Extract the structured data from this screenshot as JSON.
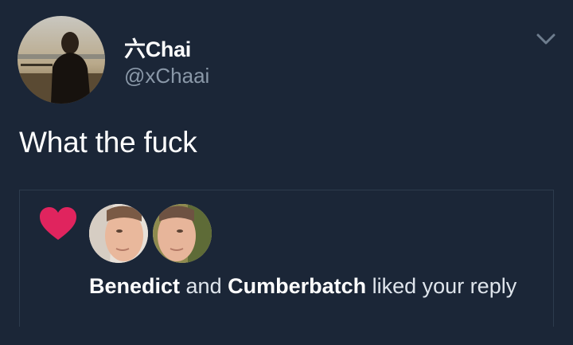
{
  "tweet": {
    "display_name": "六Chai",
    "handle": "@xChaai",
    "text": "What the fuck"
  },
  "notification": {
    "user_1": "Benedict",
    "conjunction": " and ",
    "user_2": "Cumberbatch",
    "action": " liked your reply"
  },
  "icons": {
    "menu": "chevron-down-icon",
    "like": "heart-icon"
  },
  "colors": {
    "background": "#1b2637",
    "heart": "#e0245e",
    "handle": "#8a98a8"
  }
}
